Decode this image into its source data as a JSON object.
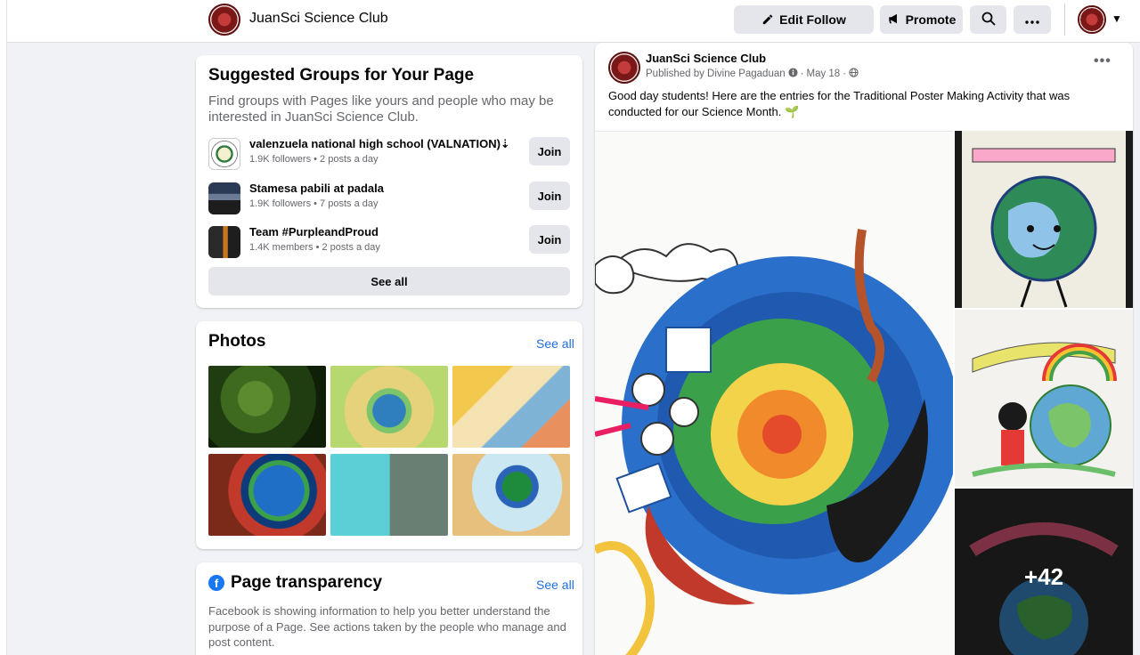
{
  "header": {
    "page_name": "JuanSci Science Club",
    "edit_follow_label": "Edit Follow",
    "promote_label": "Promote"
  },
  "suggested": {
    "title": "Suggested Groups for Your Page",
    "description": "Find groups with Pages like yours and people who may be interested in JuanSci Science Club.",
    "groups": [
      {
        "name": "valenzuela national high school (VALNATION)⇣",
        "meta": "1.9K followers • 2 posts a day",
        "join": "Join"
      },
      {
        "name": "Stamesa pabili at padala",
        "meta": "1.9K followers • 7 posts a day",
        "join": "Join"
      },
      {
        "name": "Team #PurpleandProud",
        "meta": "1.4K members • 2 posts a day",
        "join": "Join"
      }
    ],
    "see_all": "See all"
  },
  "photos": {
    "title": "Photos",
    "see_all": "See all"
  },
  "transparency": {
    "title": "Page transparency",
    "see_all": "See all",
    "description": "Facebook is showing information to help you better understand the purpose of a Page. See actions taken by the people who manage and post content."
  },
  "post": {
    "author": "JuanSci Science Club",
    "published_by": "Published by Divine Pagaduan",
    "date": "May 18",
    "text": "Good day students! Here are the entries for the Traditional Poster Making Activity that was conducted for our Science Month. 🌱",
    "more_photos": "+42"
  },
  "icons": [
    "pencil-icon",
    "megaphone-icon",
    "search-icon",
    "more-icon",
    "caret-down-icon",
    "facebook-icon",
    "globe-icon",
    "info-icon"
  ]
}
